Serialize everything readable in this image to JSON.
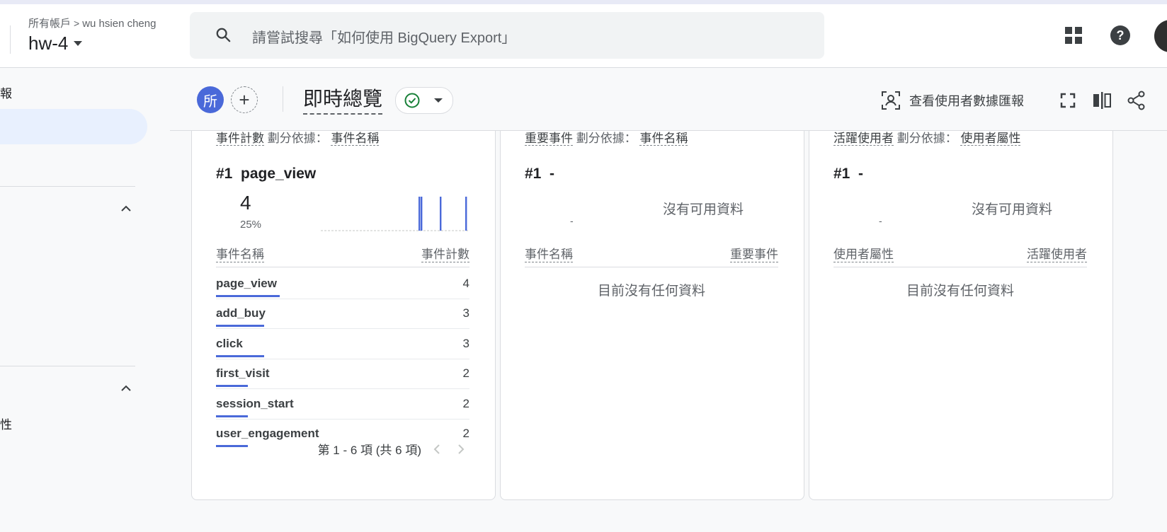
{
  "header": {
    "breadcrumb_root": "所有帳戶",
    "breadcrumb_account": "wu hsien cheng",
    "property_name": "hw-4",
    "search_placeholder": "請嘗試搜尋「如何使用 BigQuery Export」",
    "icons": [
      "apps-grid-icon",
      "help-icon",
      "account-avatar"
    ]
  },
  "sidebar": {
    "partial_item_1": "報",
    "partial_item_2": "性"
  },
  "toolbar": {
    "segment_badge": "所",
    "page_title": "即時總覽",
    "user_snapshot_label": "查看使用者數據匯報",
    "accent": "#4a69d9",
    "status_color": "#188038"
  },
  "cards": [
    {
      "metric": "事件計數",
      "split_label": "劃分依據：",
      "dimension": "事件名稱",
      "rank_prefix": "#1",
      "rank_name": "page_view",
      "top_value": "4",
      "top_percent": "25%",
      "col_left": "事件名稱",
      "col_right": "事件計數",
      "sparkline_values": [
        0,
        0,
        0,
        0,
        0,
        0,
        0,
        0,
        0,
        0,
        0,
        0,
        0,
        0,
        0,
        0,
        0,
        0,
        0,
        0,
        0,
        0,
        0,
        0,
        0,
        0,
        0,
        0,
        0,
        0,
        0,
        0,
        0,
        0,
        0,
        0,
        0,
        0,
        0,
        0,
        0,
        0,
        0,
        0,
        0,
        0,
        1,
        1,
        0,
        0,
        0,
        0,
        0,
        0,
        0,
        0,
        1,
        0,
        0,
        0,
        0,
        0,
        0,
        0,
        0,
        0,
        0,
        0,
        1,
        0
      ],
      "rows": [
        {
          "name": "page_view",
          "value": "4",
          "share": 1.0
        },
        {
          "name": "add_buy",
          "value": "3",
          "share": 0.75
        },
        {
          "name": "click",
          "value": "3",
          "share": 0.75
        },
        {
          "name": "first_visit",
          "value": "2",
          "share": 0.5
        },
        {
          "name": "session_start",
          "value": "2",
          "share": 0.5
        },
        {
          "name": "user_engagement",
          "value": "2",
          "share": 0.5
        }
      ],
      "pager_text": "第 1 - 6 項 (共 6 項)"
    },
    {
      "metric": "重要事件",
      "split_label": "劃分依據：",
      "dimension": "事件名稱",
      "rank_prefix": "#1",
      "rank_name": "-",
      "mini_dash": "-",
      "no_data": "沒有可用資料",
      "col_left": "事件名稱",
      "col_right": "重要事件",
      "empty_message": "目前沒有任何資料"
    },
    {
      "metric": "活躍使用者",
      "split_label": "劃分依據：",
      "dimension": "使用者屬性",
      "rank_prefix": "#1",
      "rank_name": "-",
      "mini_dash": "-",
      "no_data": "沒有可用資料",
      "col_left": "使用者屬性",
      "col_right": "活躍使用者",
      "empty_message": "目前沒有任何資料"
    }
  ]
}
